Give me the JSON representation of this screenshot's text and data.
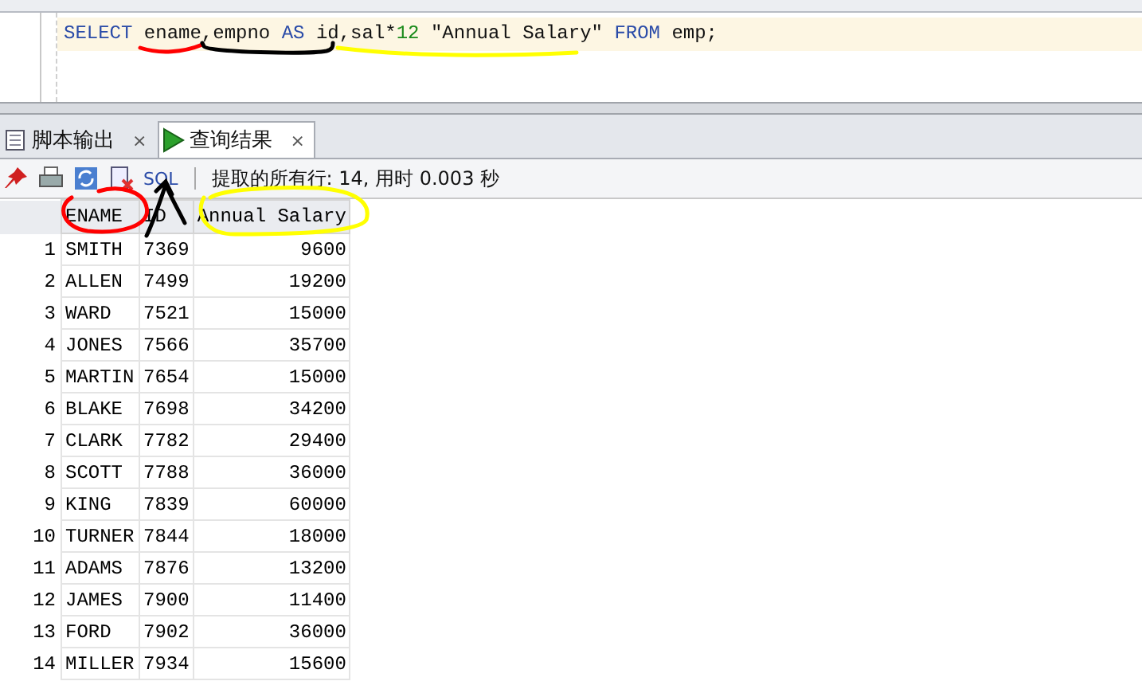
{
  "editor": {
    "sql_tokens": [
      {
        "text": "SELECT",
        "kind": "keyword"
      },
      {
        "text": " ename,empno ",
        "kind": "plain"
      },
      {
        "text": "AS",
        "kind": "keyword"
      },
      {
        "text": " id,sal*",
        "kind": "plain"
      },
      {
        "text": "12",
        "kind": "number"
      },
      {
        "text": " \"Annual Salary\" ",
        "kind": "plain"
      },
      {
        "text": "FROM",
        "kind": "keyword"
      },
      {
        "text": " emp;",
        "kind": "plain"
      }
    ]
  },
  "result_tabs": [
    {
      "label": "脚本输出",
      "kind": "script",
      "close": "×",
      "selected": false
    },
    {
      "label": "查询结果",
      "kind": "query",
      "close": "×",
      "selected": true
    }
  ],
  "toolbar": {
    "sql_link": "SQL",
    "status": "提取的所有行: 14, 用时 0.003 秒"
  },
  "table": {
    "columns": [
      "ENAME",
      "ID",
      "Annual Salary"
    ],
    "rows": [
      {
        "num": "1",
        "cells": [
          "SMITH",
          "7369",
          "9600"
        ]
      },
      {
        "num": "2",
        "cells": [
          "ALLEN",
          "7499",
          "19200"
        ]
      },
      {
        "num": "3",
        "cells": [
          "WARD",
          "7521",
          "15000"
        ]
      },
      {
        "num": "4",
        "cells": [
          "JONES",
          "7566",
          "35700"
        ]
      },
      {
        "num": "5",
        "cells": [
          "MARTIN",
          "7654",
          "15000"
        ]
      },
      {
        "num": "6",
        "cells": [
          "BLAKE",
          "7698",
          "34200"
        ]
      },
      {
        "num": "7",
        "cells": [
          "CLARK",
          "7782",
          "29400"
        ]
      },
      {
        "num": "8",
        "cells": [
          "SCOTT",
          "7788",
          "36000"
        ]
      },
      {
        "num": "9",
        "cells": [
          "KING",
          "7839",
          "60000"
        ]
      },
      {
        "num": "10",
        "cells": [
          "TURNER",
          "7844",
          "18000"
        ]
      },
      {
        "num": "11",
        "cells": [
          "ADAMS",
          "7876",
          "13200"
        ]
      },
      {
        "num": "12",
        "cells": [
          "JAMES",
          "7900",
          "11400"
        ]
      },
      {
        "num": "13",
        "cells": [
          "FORD",
          "7902",
          "36000"
        ]
      },
      {
        "num": "14",
        "cells": [
          "MILLER",
          "7934",
          "15600"
        ]
      }
    ]
  },
  "annotations": [
    {
      "kind": "underline-ename",
      "color": "#ff0000"
    },
    {
      "kind": "circle-ename",
      "color": "#ff0000"
    },
    {
      "kind": "bracket-id",
      "color": "#000000"
    },
    {
      "kind": "arrow-id",
      "color": "#000000"
    },
    {
      "kind": "underline-salary",
      "color": "#ffff00"
    },
    {
      "kind": "circle-salary",
      "color": "#ffff00"
    }
  ]
}
